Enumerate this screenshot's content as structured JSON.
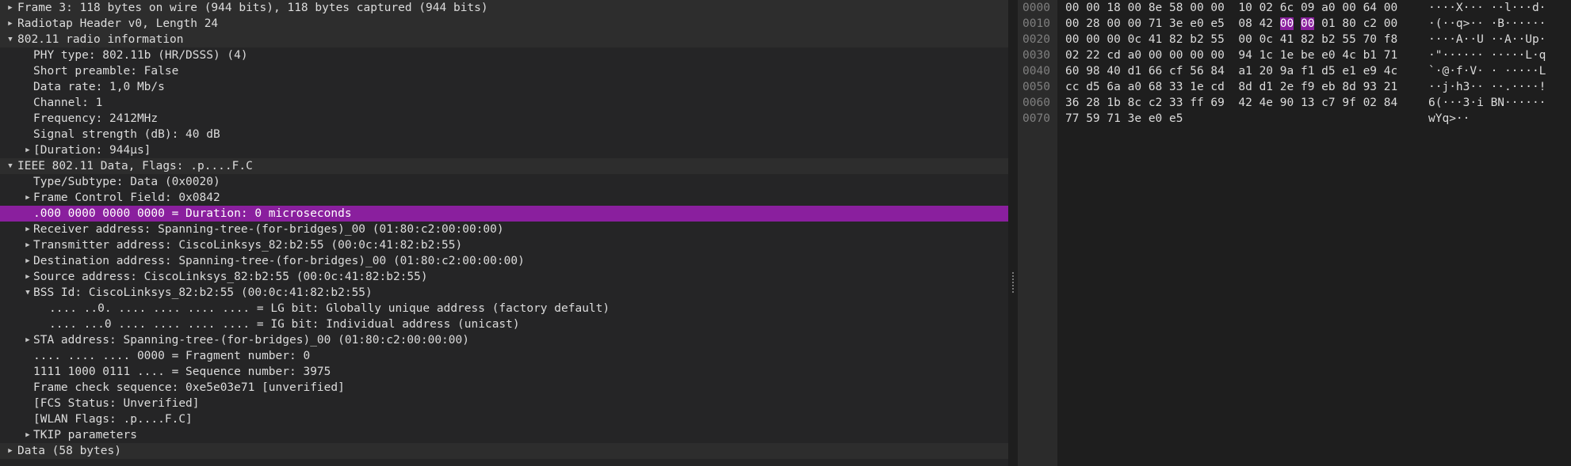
{
  "packet_details": [
    {
      "text": "Frame 3: 118 bytes on wire (944 bits), 118 bytes captured (944 bits)",
      "level": 0,
      "expander": "collapsed"
    },
    {
      "text": "Radiotap Header v0, Length 24",
      "level": 0,
      "expander": "collapsed"
    },
    {
      "text": "802.11 radio information",
      "level": 0,
      "expander": "expanded"
    },
    {
      "text": "PHY type: 802.11b (HR/DSSS) (4)",
      "level": 1,
      "expander": "none"
    },
    {
      "text": "Short preamble: False",
      "level": 1,
      "expander": "none"
    },
    {
      "text": "Data rate: 1,0 Mb/s",
      "level": 1,
      "expander": "none"
    },
    {
      "text": "Channel: 1",
      "level": 1,
      "expander": "none"
    },
    {
      "text": "Frequency: 2412MHz",
      "level": 1,
      "expander": "none"
    },
    {
      "text": "Signal strength (dB): 40 dB",
      "level": 1,
      "expander": "none"
    },
    {
      "text": "[Duration: 944µs]",
      "level": 1,
      "expander": "collapsed"
    },
    {
      "text": "IEEE 802.11 Data, Flags: .p....F.C",
      "level": 0,
      "expander": "expanded"
    },
    {
      "text": "Type/Subtype: Data (0x0020)",
      "level": 1,
      "expander": "none"
    },
    {
      "text": "Frame Control Field: 0x0842",
      "level": 1,
      "expander": "collapsed"
    },
    {
      "text": ".000 0000 0000 0000 = Duration: 0 microseconds",
      "level": 1,
      "expander": "none",
      "selected": true
    },
    {
      "text": "Receiver address: Spanning-tree-(for-bridges)_00 (01:80:c2:00:00:00)",
      "level": 1,
      "expander": "collapsed"
    },
    {
      "text": "Transmitter address: CiscoLinksys_82:b2:55 (00:0c:41:82:b2:55)",
      "level": 1,
      "expander": "collapsed"
    },
    {
      "text": "Destination address: Spanning-tree-(for-bridges)_00 (01:80:c2:00:00:00)",
      "level": 1,
      "expander": "collapsed"
    },
    {
      "text": "Source address: CiscoLinksys_82:b2:55 (00:0c:41:82:b2:55)",
      "level": 1,
      "expander": "collapsed"
    },
    {
      "text": "BSS Id: CiscoLinksys_82:b2:55 (00:0c:41:82:b2:55)",
      "level": 1,
      "expander": "expanded"
    },
    {
      "text": ".... ..0. .... .... .... .... = LG bit: Globally unique address (factory default)",
      "level": 2,
      "expander": "none"
    },
    {
      "text": ".... ...0 .... .... .... .... = IG bit: Individual address (unicast)",
      "level": 2,
      "expander": "none"
    },
    {
      "text": "STA address: Spanning-tree-(for-bridges)_00 (01:80:c2:00:00:00)",
      "level": 1,
      "expander": "collapsed"
    },
    {
      "text": ".... .... .... 0000 = Fragment number: 0",
      "level": 1,
      "expander": "none"
    },
    {
      "text": "1111 1000 0111 .... = Sequence number: 3975",
      "level": 1,
      "expander": "none"
    },
    {
      "text": "Frame check sequence: 0xe5e03e71 [unverified]",
      "level": 1,
      "expander": "none"
    },
    {
      "text": "[FCS Status: Unverified]",
      "level": 1,
      "expander": "none"
    },
    {
      "text": "[WLAN Flags: .p....F.C]",
      "level": 1,
      "expander": "none"
    },
    {
      "text": "TKIP parameters",
      "level": 1,
      "expander": "collapsed"
    },
    {
      "text": "Data (58 bytes)",
      "level": 0,
      "expander": "collapsed"
    }
  ],
  "hex_dump": [
    {
      "offset": "0000",
      "bytes": [
        "00",
        "00",
        "18",
        "00",
        "8e",
        "58",
        "00",
        "00",
        "10",
        "02",
        "6c",
        "09",
        "a0",
        "00",
        "64",
        "00"
      ],
      "ascii": "····X···",
      "ascii2": "··l···d·",
      "hl": []
    },
    {
      "offset": "0010",
      "bytes": [
        "00",
        "28",
        "00",
        "00",
        "71",
        "3e",
        "e0",
        "e5",
        "08",
        "42",
        "00",
        "00",
        "01",
        "80",
        "c2",
        "00"
      ],
      "ascii": "·(··q>··",
      "ascii2": "·B······",
      "hl": [
        10,
        11
      ]
    },
    {
      "offset": "0020",
      "bytes": [
        "00",
        "00",
        "00",
        "0c",
        "41",
        "82",
        "b2",
        "55",
        "00",
        "0c",
        "41",
        "82",
        "b2",
        "55",
        "70",
        "f8"
      ],
      "ascii": "····A··U",
      "ascii2": "··A··Up·",
      "hl": []
    },
    {
      "offset": "0030",
      "bytes": [
        "02",
        "22",
        "cd",
        "a0",
        "00",
        "00",
        "00",
        "00",
        "94",
        "1c",
        "1e",
        "be",
        "e0",
        "4c",
        "b1",
        "71"
      ],
      "ascii": "·\"······",
      "ascii2": "·····L·q",
      "hl": []
    },
    {
      "offset": "0040",
      "bytes": [
        "60",
        "98",
        "40",
        "d1",
        "66",
        "cf",
        "56",
        "84",
        "a1",
        "20",
        "9a",
        "f1",
        "d5",
        "e1",
        "e9",
        "4c"
      ],
      "ascii": "`·@·f·V·",
      "ascii2": "· ·····L",
      "hl": []
    },
    {
      "offset": "0050",
      "bytes": [
        "cc",
        "d5",
        "6a",
        "a0",
        "68",
        "33",
        "1e",
        "cd",
        "8d",
        "d1",
        "2e",
        "f9",
        "eb",
        "8d",
        "93",
        "21"
      ],
      "ascii": "··j·h3··",
      "ascii2": "··.····!",
      "hl": []
    },
    {
      "offset": "0060",
      "bytes": [
        "36",
        "28",
        "1b",
        "8c",
        "c2",
        "33",
        "ff",
        "69",
        "42",
        "4e",
        "90",
        "13",
        "c7",
        "9f",
        "02",
        "84"
      ],
      "ascii": "6(···3·i",
      "ascii2": "BN······",
      "hl": []
    },
    {
      "offset": "0070",
      "bytes": [
        "77",
        "59",
        "71",
        "3e",
        "e0",
        "e5"
      ],
      "ascii": "wYq>··",
      "ascii2": "",
      "hl": []
    }
  ],
  "colors": {
    "selection": "#8a1f9e",
    "tree_background": "#252526",
    "tree_alt_row": "#2d2d2d",
    "hex_background": "#1e1e1e",
    "offset_text": "#7f7f7f",
    "text": "#dcdcdc"
  },
  "icons": {
    "collapsed": "triangle-right-icon",
    "expanded": "triangle-down-icon"
  }
}
